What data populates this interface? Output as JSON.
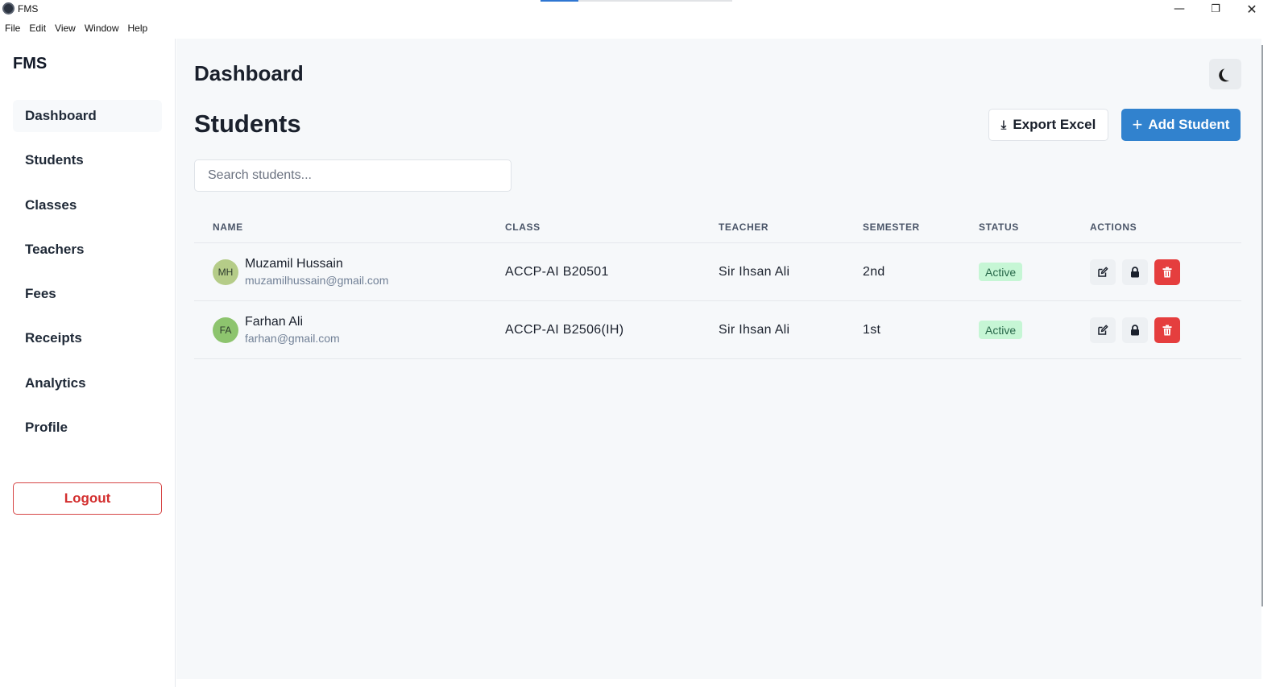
{
  "window": {
    "title": "FMS",
    "controls": {
      "minimize": "—",
      "restore": "❐",
      "close": "✕"
    }
  },
  "menu": [
    "File",
    "Edit",
    "View",
    "Window",
    "Help"
  ],
  "sidebar": {
    "brand": "FMS",
    "items": [
      {
        "label": "Dashboard",
        "active": true
      },
      {
        "label": "Students",
        "active": false
      },
      {
        "label": "Classes",
        "active": false
      },
      {
        "label": "Teachers",
        "active": false
      },
      {
        "label": "Fees",
        "active": false
      },
      {
        "label": "Receipts",
        "active": false
      },
      {
        "label": "Analytics",
        "active": false
      },
      {
        "label": "Profile",
        "active": false
      }
    ],
    "logout_label": "Logout"
  },
  "header": {
    "title": "Dashboard",
    "theme_toggle_icon": "moon-icon"
  },
  "students": {
    "title": "Students",
    "export_label": "Export Excel",
    "add_label": "Add Student",
    "search_placeholder": "Search students...",
    "columns": [
      "NAME",
      "CLASS",
      "TEACHER",
      "SEMESTER",
      "STATUS",
      "ACTIONS"
    ],
    "rows": [
      {
        "initials": "MH",
        "avatar_color": "#b5cc88",
        "name": "Muzamil Hussain",
        "email": "muzamilhussain@gmail.com",
        "class": "ACCP-AI B20501",
        "teacher": "Sir Ihsan Ali",
        "semester": "2nd",
        "status": "Active"
      },
      {
        "initials": "FA",
        "avatar_color": "#8dc46e",
        "name": "Farhan Ali",
        "email": "farhan@gmail.com",
        "class": "ACCP-AI B2506(IH)",
        "teacher": "Sir Ihsan Ali",
        "semester": "1st",
        "status": "Active"
      }
    ]
  },
  "colors": {
    "primary": "#3182ce",
    "danger": "#e53e3e",
    "status_active_bg": "#c6f6d5",
    "status_active_text": "#276749"
  }
}
